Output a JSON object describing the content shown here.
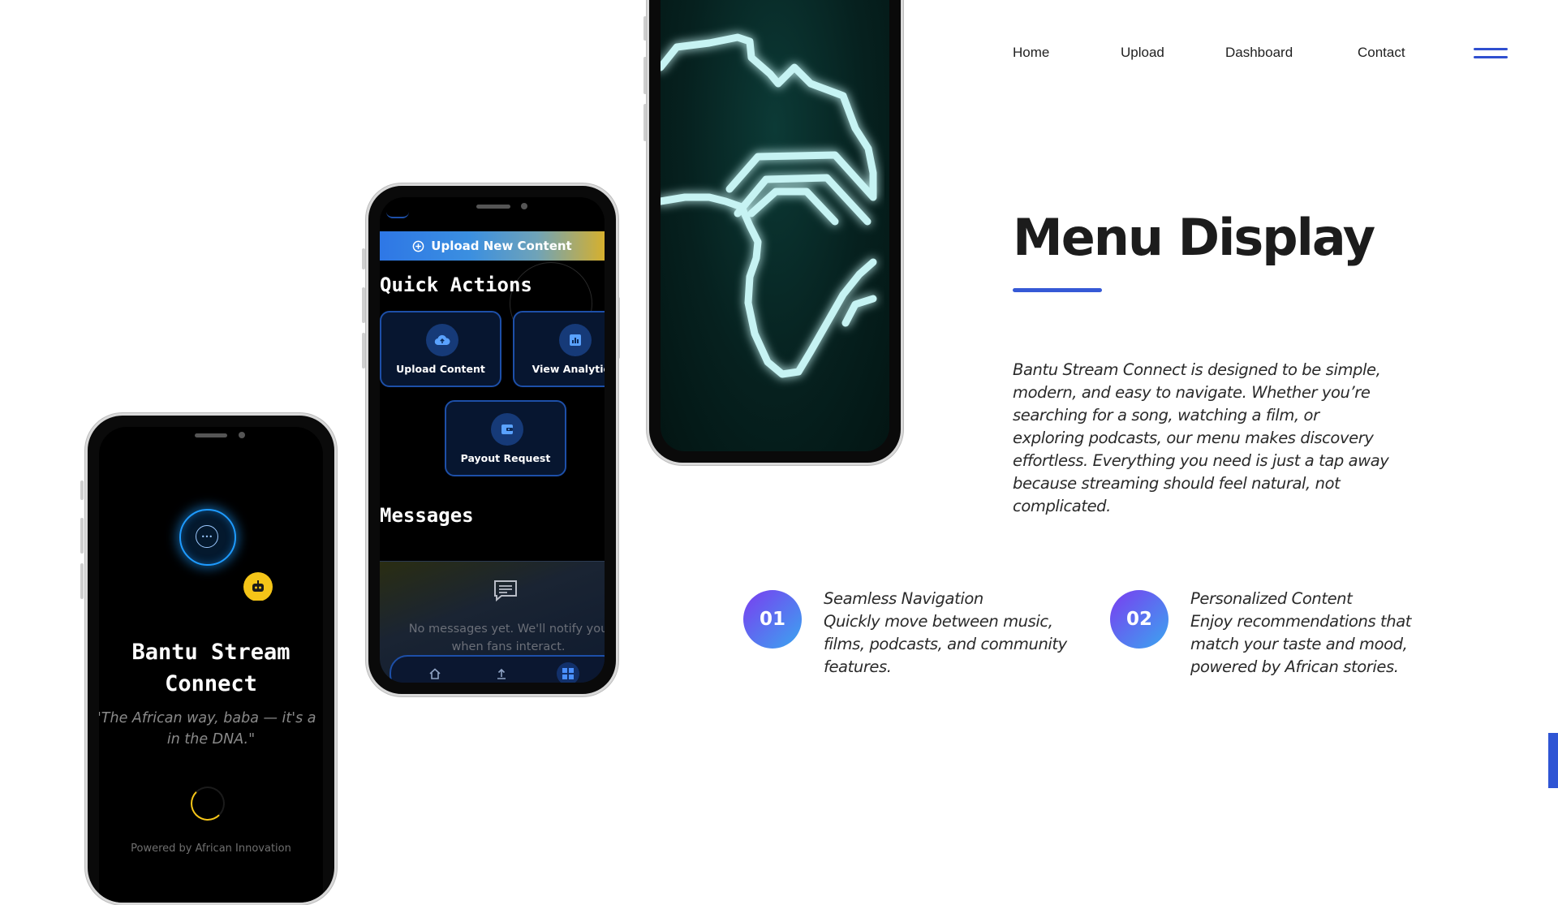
{
  "nav": {
    "items": [
      "Home",
      "Upload",
      "Dashboard",
      "Contact"
    ]
  },
  "main": {
    "title": "Menu Display",
    "description": "Bantu Stream Connect is designed to be simple, modern, and easy to navigate. Whether you’re searching for a song, watching a film, or exploring podcasts, our menu makes discovery effortless. Everything you need is just a tap away because streaming should feel natural, not complicated.",
    "features": [
      {
        "number": "01",
        "title": "Seamless Navigation",
        "text": "Quickly move between music, films, podcasts, and community features."
      },
      {
        "number": "02",
        "title": "Personalized Content",
        "text": "Enjoy recommendations that match your taste and mood, powered by African stories."
      }
    ]
  },
  "phone_splash": {
    "app_name_line1": "Bantu Stream",
    "app_name_line2": "Connect",
    "quote_line1": "'The African way, baba — it's a",
    "quote_line2": "in the DNA.\"",
    "powered_by": "Powered by African Innovation",
    "accent": "#f5c518",
    "glow": "#1e9bff"
  },
  "phone_dashboard": {
    "upload_banner": "Upload New Content",
    "quick_actions_heading": "Quick Actions",
    "actions": [
      "Upload Content",
      "View Analytics",
      "Payout Request"
    ],
    "messages_heading": "Messages",
    "empty_line1": "No messages yet. We'll notify you",
    "empty_line2": "when fans interact."
  },
  "phone_map": {
    "neon_color": "#c6f3f3"
  },
  "colors": {
    "accent": "#3559d6",
    "badge_gradient_start": "#7a3cf0",
    "badge_gradient_end": "#3aa6f0"
  }
}
